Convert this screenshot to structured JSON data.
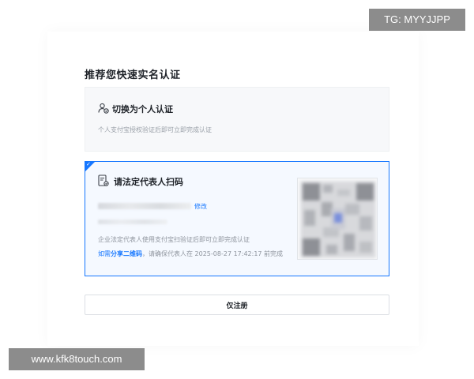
{
  "page": {
    "heading": "推荐您快速实名认证"
  },
  "personal_option": {
    "title": "切换为个人认证",
    "description": "个人支付宝授权验证后即可立即完成认证",
    "icon": "user-switch-icon"
  },
  "legal_rep_option": {
    "title": "请法定代表人扫码",
    "icon": "scan-document-icon",
    "edit_label": "修改",
    "description": "企业法定代表人使用支付宝扫验证后即可立即完成认证",
    "share_prefix": "如需",
    "share_link": "分享二维码",
    "share_suffix": "，请确保代表人在 2025-08-27 17:42:17 前完成",
    "selected": true
  },
  "actions": {
    "register_only_label": "仅注册"
  },
  "watermarks": {
    "top_right": "TG: MYYJJPP",
    "bottom_left": "www.kfk8touch.com"
  },
  "colors": {
    "accent": "#1677ff",
    "selected_card_bg": "#f5f9ff",
    "option_card_bg": "#f7f8fa",
    "watermark_bg": "#8c8c8c"
  }
}
